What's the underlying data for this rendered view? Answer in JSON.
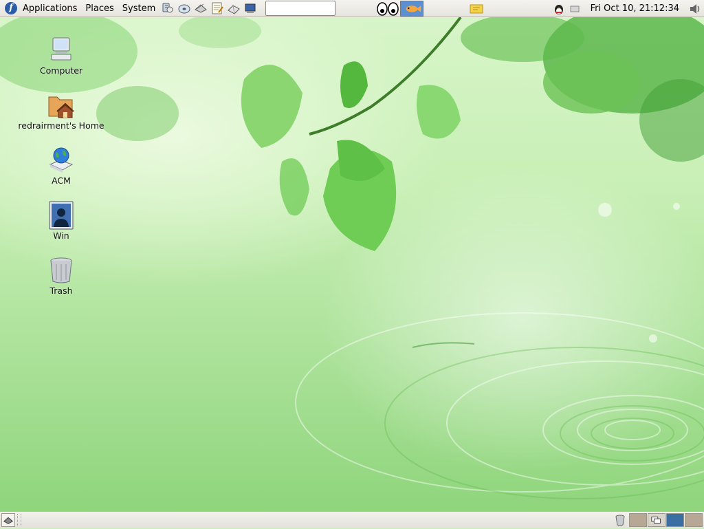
{
  "top_panel": {
    "menus": {
      "applications": "Applications",
      "places": "Places",
      "system": "System"
    },
    "launchers": [
      {
        "icon": "network-tools-icon"
      },
      {
        "icon": "disk-icon"
      },
      {
        "icon": "email-icon"
      },
      {
        "icon": "text-editor-icon"
      },
      {
        "icon": "notebook-icon"
      },
      {
        "icon": "monitor-icon"
      }
    ],
    "search_value": "",
    "applets": [
      "eyes-icon",
      "fish-icon",
      "notes-icon"
    ],
    "tray": [
      "qq-penguin-icon",
      "keyboard-icon"
    ],
    "clock": "Fri Oct 10, 21:12:34",
    "volume_icon": "speaker-icon"
  },
  "desktop": {
    "icons": [
      {
        "label": "Computer",
        "icon": "computer-icon"
      },
      {
        "label": "redrairment's Home",
        "icon": "home-folder-icon"
      },
      {
        "label": "ACM",
        "icon": "network-globe-icon"
      },
      {
        "label": "Win",
        "icon": "user-screen-icon"
      },
      {
        "label": "Trash",
        "icon": "trash-icon"
      }
    ]
  },
  "bottom_panel": {
    "show_desktop_icon": "show-desktop-icon",
    "trash_icon": "trash-icon",
    "workspaces": [
      {
        "active": false,
        "color": "#b7a895"
      },
      {
        "active": false,
        "color": "#d9d5cc"
      },
      {
        "active": true,
        "color": "#3b6fa3"
      },
      {
        "active": false,
        "color": "#b7a895"
      }
    ]
  },
  "colors": {
    "panel": "#e8e6e0",
    "accent": "#3b6fa3",
    "wallpaper": "#a8e090"
  }
}
